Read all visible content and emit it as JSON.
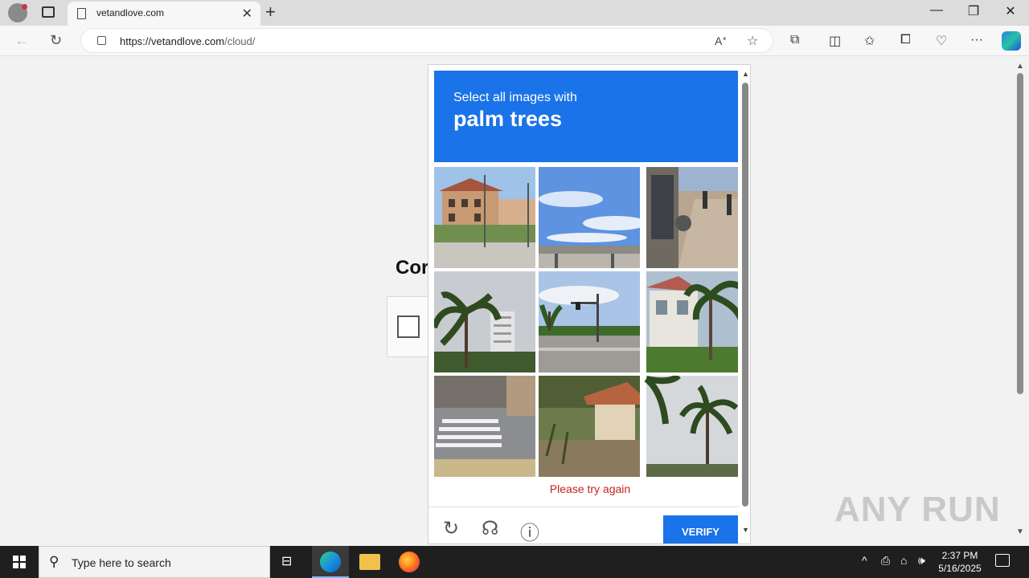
{
  "browser": {
    "tab_title": "vetandlove.com",
    "url_host": "https://vetandlove.com",
    "url_path": "/cloud/"
  },
  "page": {
    "heading_partial": "Cor"
  },
  "captcha": {
    "instruction": "Select all images with",
    "target": "palm trees",
    "tiles": [
      {
        "scene": "building-street"
      },
      {
        "scene": "sky-bridge"
      },
      {
        "scene": "sidewalk-people"
      },
      {
        "scene": "palm-highrise"
      },
      {
        "scene": "intersection"
      },
      {
        "scene": "house-palm"
      },
      {
        "scene": "crosswalk"
      },
      {
        "scene": "shelter-field"
      },
      {
        "scene": "palm-sky"
      }
    ],
    "error": "Please try again",
    "verify_label": "VERIFY",
    "icons": [
      "reload-icon",
      "audio-icon",
      "info-icon"
    ]
  },
  "taskbar": {
    "search_placeholder": "Type here to search",
    "time": "2:37 PM",
    "date": "5/16/2025"
  },
  "watermark": "ANY RUN"
}
